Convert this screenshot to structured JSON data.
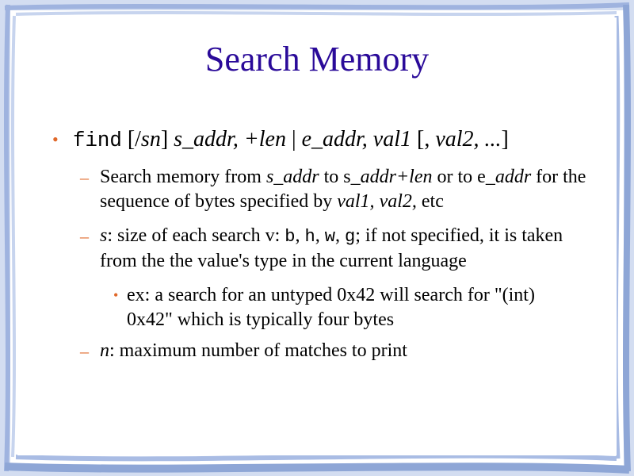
{
  "title": "Search Memory",
  "bullet1": {
    "cmd": "find",
    "p1": " [/",
    "p2": "sn",
    "p3": "] ",
    "p4": "s_addr, +len",
    "p5": " | ",
    "p6": "e_addr, val1",
    "p7": " [, ",
    "p8": "val2, ...",
    "p9": "]"
  },
  "sub1": {
    "a": "Search memory from ",
    "b": "s_addr",
    "c": " to s",
    "d": "_addr+len",
    "e": " or to e",
    "f": "_addr",
    "g": " for the sequence of bytes specified by ",
    "h": "val1,",
    "i": " ",
    "j": "val2,",
    "k": " etc"
  },
  "sub2": {
    "a": "s",
    "b": ": size of each search v: ",
    "c": "b",
    "d": ", ",
    "e": "h",
    "f": ", ",
    "g": "w",
    "h": ", ",
    "i": "g",
    "j": "; if not specified, it is taken from the the value's type in the current language"
  },
  "sub2_item": "ex: a search for an untyped 0x42 will search for \"(int) 0x42\" which is typically four bytes",
  "sub3": {
    "a": "n",
    "b": ": maximum number of matches to print"
  },
  "colors": {
    "title": "#2a0a99",
    "bullet": "#e0682a",
    "frame": "#8ea6d6"
  },
  "icons": {
    "bullet": "•",
    "dash": "–"
  }
}
